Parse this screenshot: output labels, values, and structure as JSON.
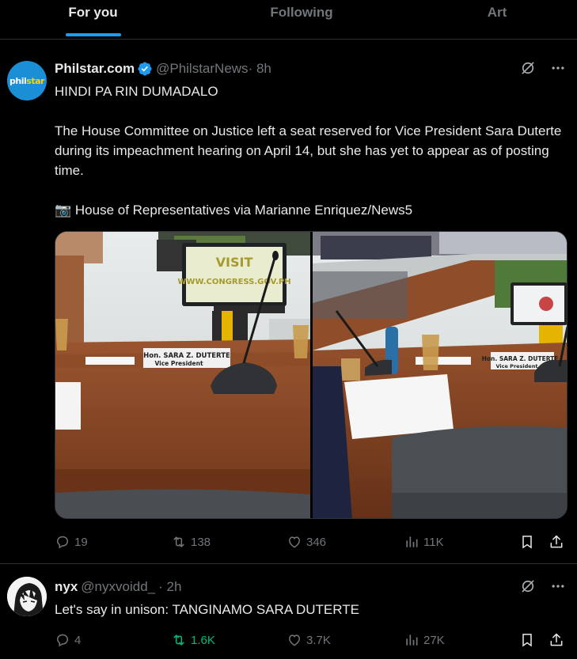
{
  "tabs": [
    {
      "label": "For you",
      "active": true
    },
    {
      "label": "Following",
      "active": false
    },
    {
      "label": "Art",
      "active": false
    }
  ],
  "posts": [
    {
      "author": "Philstar.com",
      "handle": "@PhilstarNews",
      "time": "· 8h",
      "verified": true,
      "avatar_logo": {
        "part1": "phil",
        "part2": "star"
      },
      "lines": [
        "HINDI PA RIN DUMADALO",
        "The House Committee on Justice left a seat reserved for Vice President Sara Duterte during its impeachment hearing on April 14, but she has yet to appear as of posting time.",
        "📷 House of Representatives via Marianne Enriquez/News5"
      ],
      "photo_left": {
        "screen_text": "VISIT\nWWW.CONGRESS.GOV.PH",
        "nameplate": "Hon. SARA Z. DUTERTE",
        "nameplate_sub": "Vice President"
      },
      "photo_right": {
        "nameplate": "Hon. SARA Z. DUTERTE",
        "nameplate_sub": "Vice President"
      },
      "stats": {
        "replies": "19",
        "reposts": "138",
        "likes": "346",
        "views": "11K"
      }
    },
    {
      "author": "nyx",
      "handle": "@nyxvoidd_",
      "time": "· 2h",
      "verified": false,
      "lines": [
        "Let's say in unison: TANGINAMO SARA DUTERTE"
      ],
      "stats": {
        "replies": "4",
        "reposts": "1.6K",
        "likes": "3.7K",
        "views": "27K"
      }
    }
  ],
  "colors": {
    "accent": "#1d9bf0",
    "muted": "#71767b",
    "repost_active": "#00ba7c",
    "border": "#2f3336"
  }
}
